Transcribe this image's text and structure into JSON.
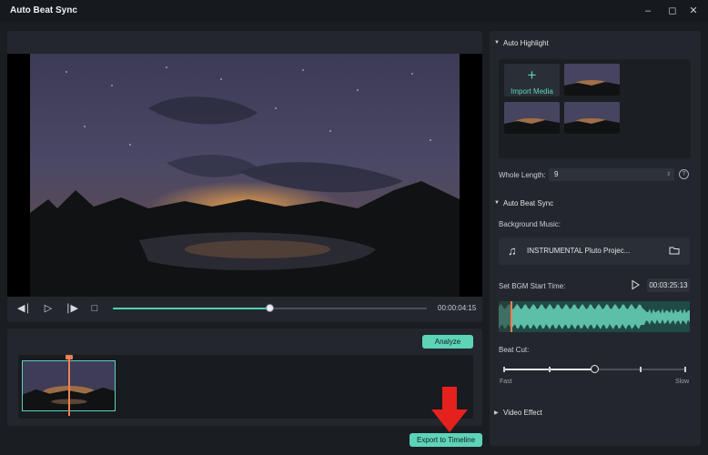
{
  "window": {
    "title": "Auto Beat Sync",
    "minimize_icon": "minimize-icon",
    "maximize_icon": "maximize-icon",
    "close_icon": "close-icon"
  },
  "player": {
    "timecode": "00:00:04:15",
    "progress_fraction": 0.5
  },
  "bottom": {
    "analyze_label": "Analyze",
    "export_label": "Export to Timeline"
  },
  "right": {
    "auto_highlight_title": "Auto Highlight",
    "import_media_label": "Import Media",
    "whole_length_label": "Whole Length:",
    "whole_length_value": "9",
    "help_symbol": "?",
    "auto_beat_sync_title": "Auto Beat Sync",
    "background_music_label": "Background Music:",
    "music_name": "INSTRUMENTAL  Pluto Projec...",
    "bgm_start_label": "Set BGM Start Time:",
    "bgm_start_time": "00:03:25:13",
    "beat_cut_label": "Beat Cut:",
    "beat_cut_fraction": 0.5,
    "fast_label": "Fast",
    "slow_label": "Slow",
    "video_effect_title": "Video Effect"
  },
  "colors": {
    "accent": "#5dd3b8",
    "playhead": "#f07f55",
    "arrow": "#e5211e"
  }
}
